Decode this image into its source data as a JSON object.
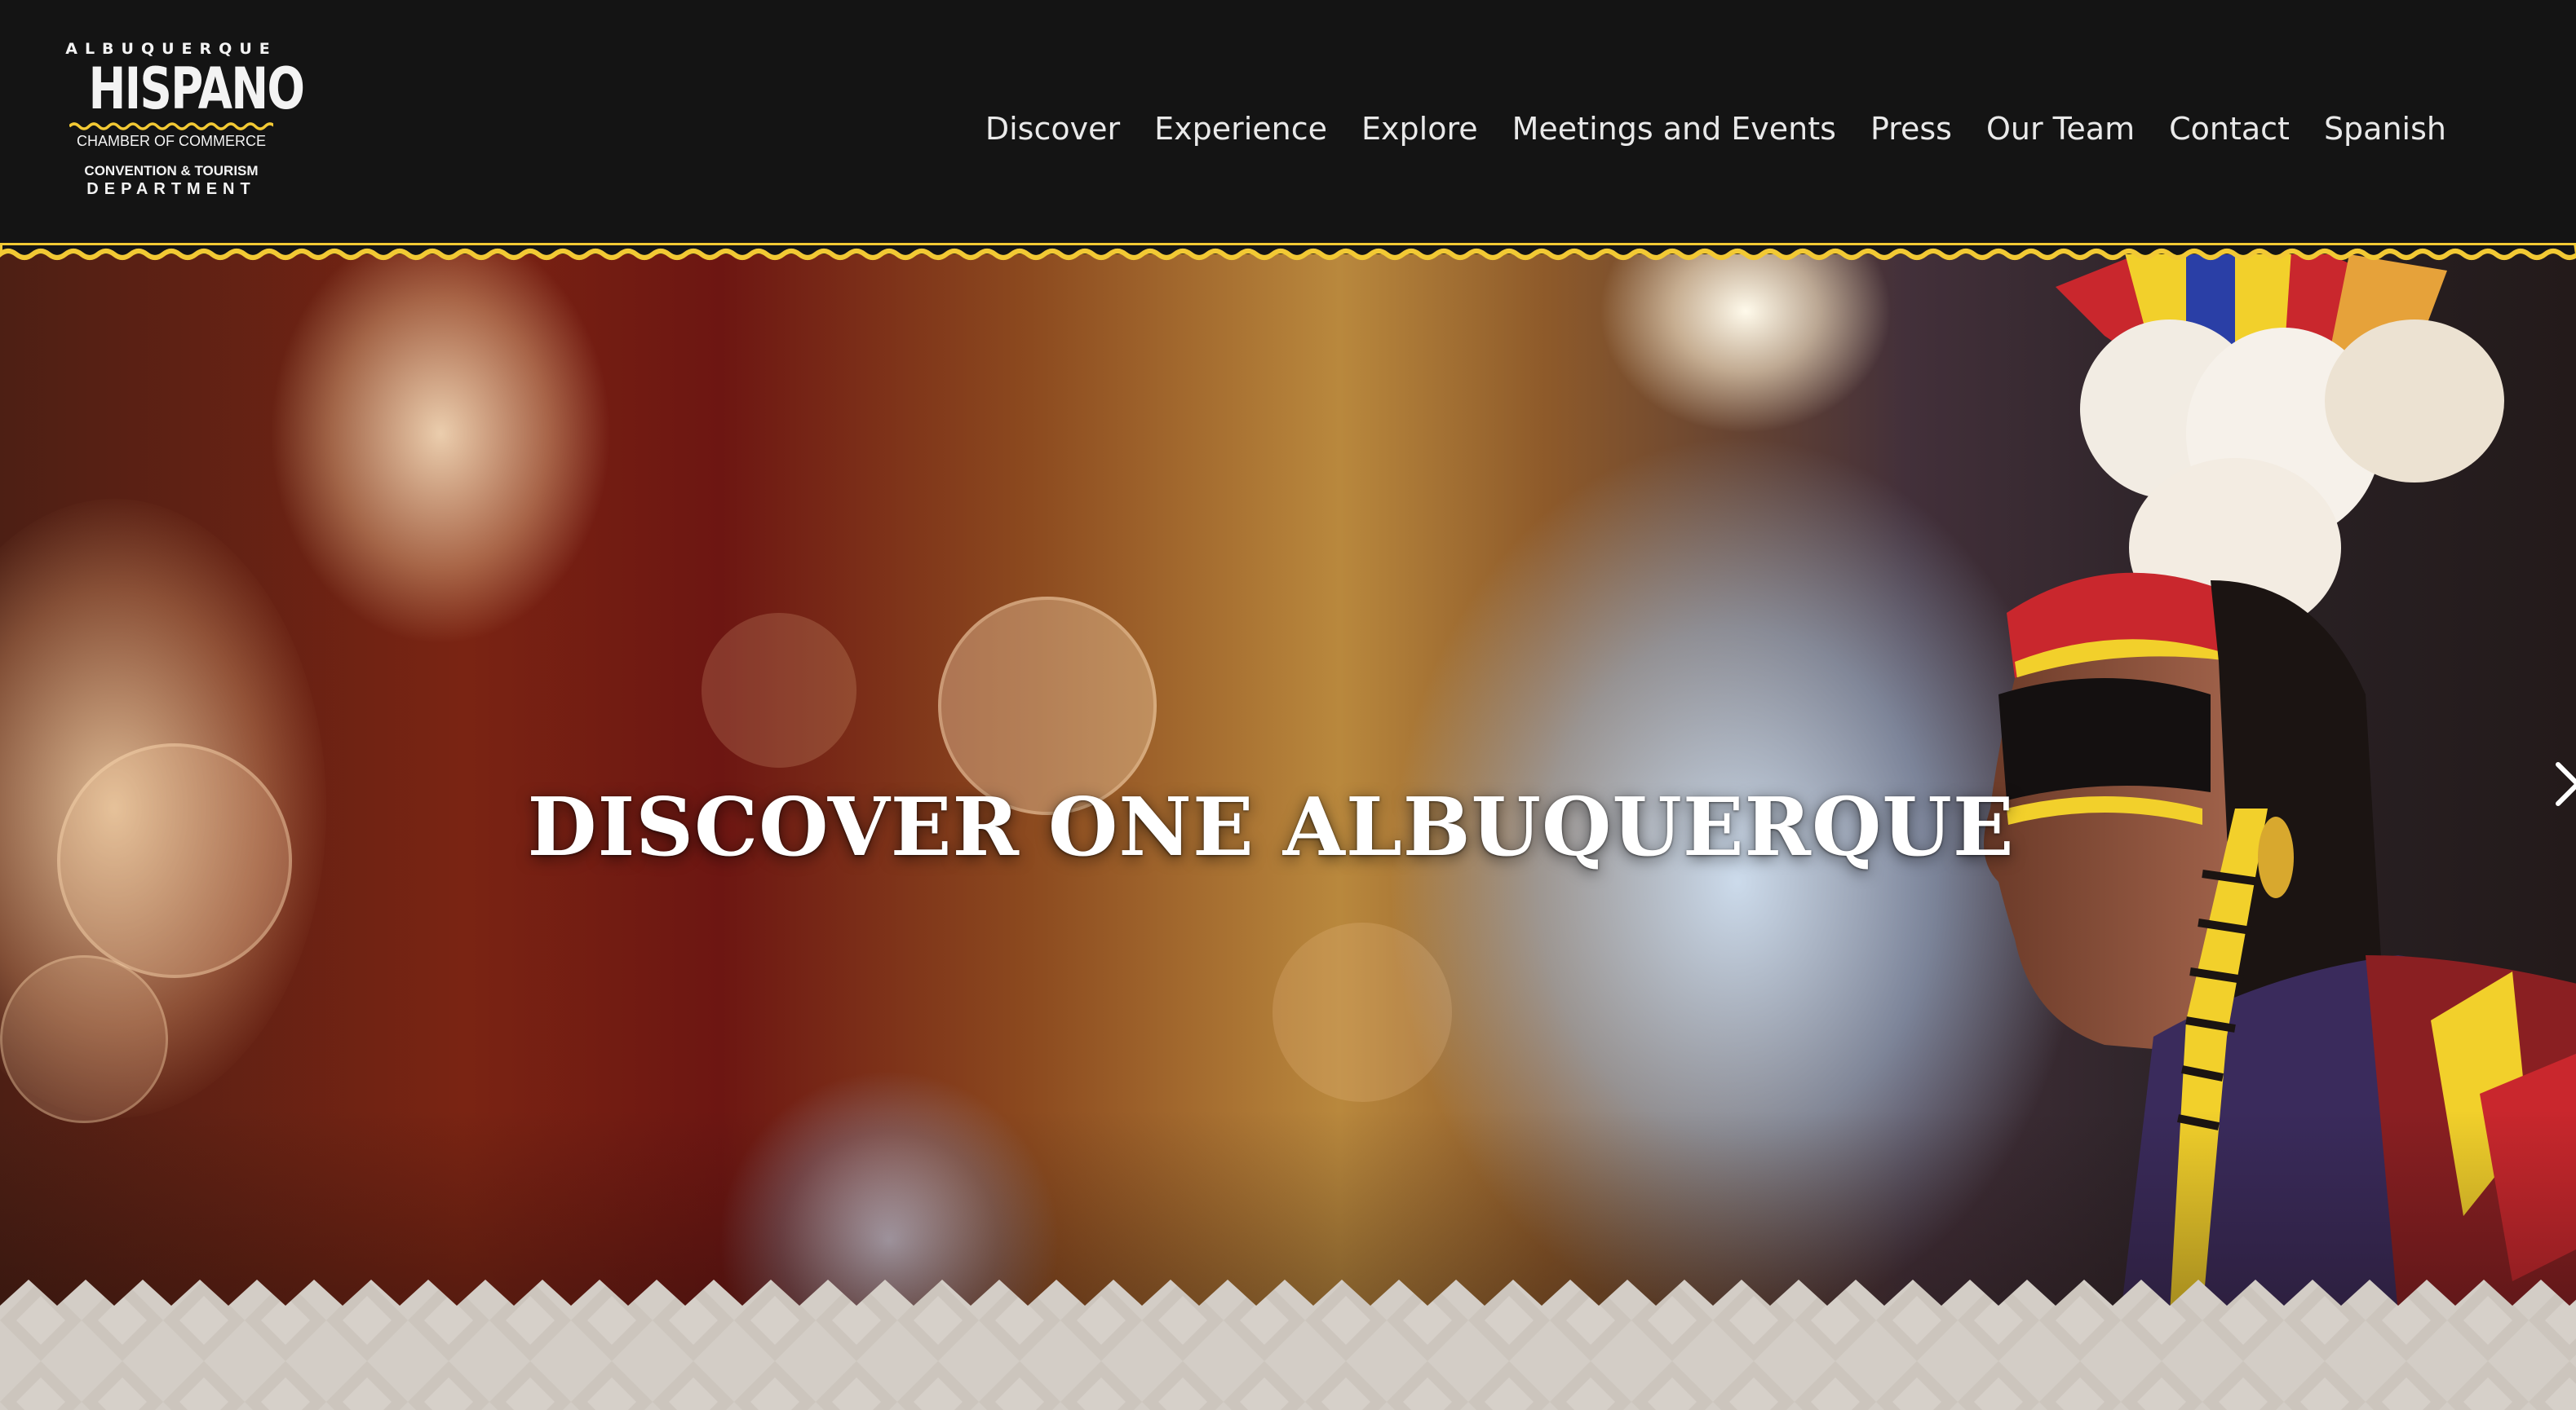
{
  "logo": {
    "top": "ALBUQUERQUE",
    "main": "HISPANO",
    "sub": "CHAMBER OF COMMERCE",
    "conv": "CONVENTION & TOURISM",
    "dept": "DEPARTMENT"
  },
  "nav": {
    "items": [
      {
        "label": "Discover"
      },
      {
        "label": "Experience"
      },
      {
        "label": "Explore"
      },
      {
        "label": "Meetings and Events"
      },
      {
        "label": "Press"
      },
      {
        "label": "Our Team"
      },
      {
        "label": "Contact"
      },
      {
        "label": "Spanish"
      }
    ]
  },
  "hero": {
    "title": "DISCOVER ONE ALBUQUERQUE"
  },
  "colors": {
    "header_bg": "#141414",
    "accent_yellow": "#f2c934",
    "band_bg": "#d3cdc6",
    "nav_text": "#e9e9e9"
  },
  "icons": {
    "slider_next": "chevron-right-icon"
  }
}
